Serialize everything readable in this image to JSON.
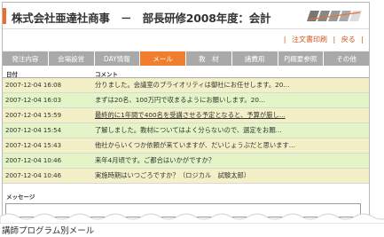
{
  "header": {
    "title": "株式会社亜達社商事　－　部長研修2008年度：会計"
  },
  "links": {
    "print": "注文書印刷",
    "back": "戻る"
  },
  "tabs": [
    {
      "label": "発注内容"
    },
    {
      "label": "会場設営"
    },
    {
      "label": "DAY情報"
    },
    {
      "label": "メール"
    },
    {
      "label": "教　材"
    },
    {
      "label": "諸費用"
    },
    {
      "label": "PJ概要参照"
    },
    {
      "label": "その他"
    }
  ],
  "active_tab": "メール",
  "table": {
    "col_date": "日付",
    "col_comment": "コメント",
    "rows": [
      {
        "date": "2007-12-04 16:08",
        "message": "分りました。会議室のプライオリティは御社にお任せします。20..."
      },
      {
        "date": "2007-12-04 16:03",
        "message": "まずは20名、100万円で収まるようにお願いします。20..."
      },
      {
        "date": "2007-12-04 15:59",
        "message": "最終的に1年間で400名を受講させる予定となると、予算が厳し..."
      },
      {
        "date": "2007-12-04 15:54",
        "message": "了解しました。教材についてはよく分らないので、選定をお願..."
      },
      {
        "date": "2007-12-04 15:43",
        "message": "他社からいくつか依頼が来ていますが、だいじょうぶだと思います..."
      },
      {
        "date": "2007-12-04 10:46",
        "message": "来年4月頃です。ご都合はいかがですか？"
      },
      {
        "date": "2007-12-04 10:46",
        "message": "実施時期はいつごろですか？（ロジカル　試験太郎）"
      }
    ]
  },
  "message_section": {
    "label": "メッセージ"
  },
  "caption": "講師プログラム別メール",
  "colors": {
    "accent": "#ef7f2e",
    "tab_inactive": "#a9a9a9",
    "row_odd": "#f3f0c8",
    "row_even": "#e3f4c6"
  }
}
